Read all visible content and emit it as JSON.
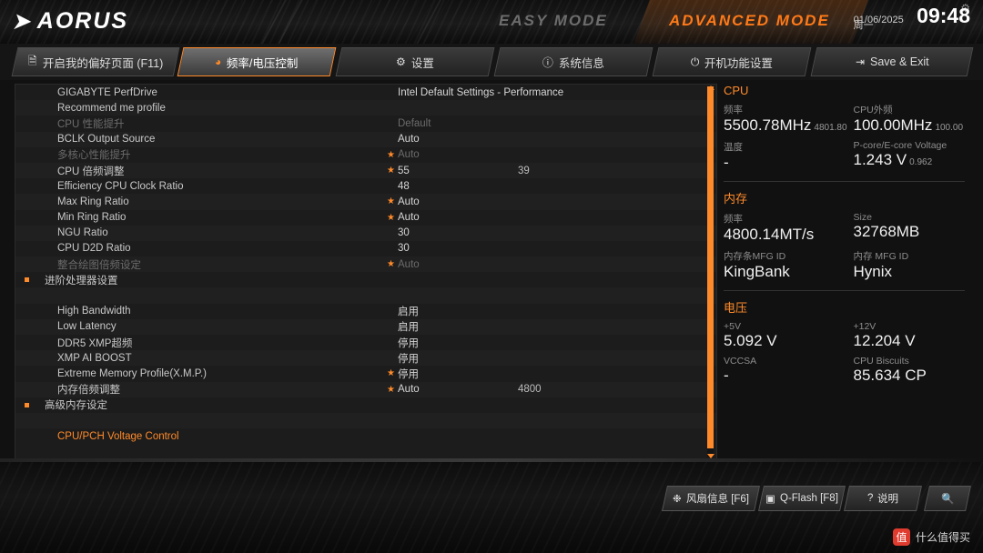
{
  "header": {
    "logo_text": "AORUS",
    "easy_mode": "EASY MODE",
    "advanced_mode": "ADVANCED MODE",
    "date": "01/06/2025",
    "weekday": "周一",
    "time": "09:48",
    "gear_icon": "gear-icon"
  },
  "tabs": [
    {
      "label": "开启我的偏好页面 (F11)",
      "icon": "bookmark-icon",
      "active": false
    },
    {
      "label": "频率/电压控制",
      "icon": "speedometer-icon",
      "active": true
    },
    {
      "label": "设置",
      "icon": "gear-icon",
      "active": false
    },
    {
      "label": "系统信息",
      "icon": "info-icon",
      "active": false
    },
    {
      "label": "开机功能设置",
      "icon": "power-icon",
      "active": false
    },
    {
      "label": "Save & Exit",
      "icon": "exit-icon",
      "active": false
    }
  ],
  "settings_rows": [
    {
      "label": "GIGABYTE PerfDrive",
      "value": "Intel Default Settings - Performance",
      "value2": "",
      "star": false,
      "dim": false,
      "bullet": false,
      "header": false
    },
    {
      "label": "Recommend me profile",
      "value": "",
      "value2": "",
      "star": false,
      "dim": false,
      "bullet": false,
      "header": false
    },
    {
      "label": "CPU 性能提升",
      "value": "Default",
      "value2": "",
      "star": false,
      "dim": true,
      "bullet": false,
      "header": false
    },
    {
      "label": "BCLK Output Source",
      "value": "Auto",
      "value2": "",
      "star": false,
      "dim": false,
      "bullet": false,
      "header": false
    },
    {
      "label": "多核心性能提升",
      "value": "Auto",
      "value2": "",
      "star": true,
      "dim": true,
      "bullet": false,
      "header": false
    },
    {
      "label": "CPU 倍频调整",
      "value": "55",
      "value2": "39",
      "star": true,
      "dim": false,
      "bullet": false,
      "header": false
    },
    {
      "label": "Efficiency CPU Clock Ratio",
      "value": "48",
      "value2": "",
      "star": false,
      "dim": false,
      "bullet": false,
      "header": false
    },
    {
      "label": "Max Ring Ratio",
      "value": "Auto",
      "value2": "",
      "star": true,
      "dim": false,
      "bullet": false,
      "header": false
    },
    {
      "label": "Min Ring Ratio",
      "value": "Auto",
      "value2": "",
      "star": true,
      "dim": false,
      "bullet": false,
      "header": false
    },
    {
      "label": "NGU Ratio",
      "value": "30",
      "value2": "",
      "star": false,
      "dim": false,
      "bullet": false,
      "header": false
    },
    {
      "label": "CPU D2D Ratio",
      "value": "30",
      "value2": "",
      "star": false,
      "dim": false,
      "bullet": false,
      "header": false
    },
    {
      "label": "整合绘图倍频设定",
      "value": "Auto",
      "value2": "",
      "star": true,
      "dim": true,
      "bullet": false,
      "header": false
    },
    {
      "label": "进阶处理器设置",
      "value": "",
      "value2": "",
      "star": false,
      "dim": false,
      "bullet": true,
      "header": false
    },
    {
      "label": "",
      "value": "",
      "value2": "",
      "star": false,
      "dim": false,
      "bullet": false,
      "header": false
    },
    {
      "label": "High Bandwidth",
      "value": "启用",
      "value2": "",
      "star": false,
      "dim": false,
      "bullet": false,
      "header": false
    },
    {
      "label": "Low Latency",
      "value": "启用",
      "value2": "",
      "star": false,
      "dim": false,
      "bullet": false,
      "header": false
    },
    {
      "label": "DDR5 XMP超频",
      "value": "停用",
      "value2": "",
      "star": false,
      "dim": false,
      "bullet": false,
      "header": false
    },
    {
      "label": "XMP AI BOOST",
      "value": "停用",
      "value2": "",
      "star": false,
      "dim": false,
      "bullet": false,
      "header": false
    },
    {
      "label": "Extreme Memory Profile(X.M.P.)",
      "value": "停用",
      "value2": "",
      "star": true,
      "dim": false,
      "bullet": false,
      "header": false
    },
    {
      "label": "内存倍频调整",
      "value": "Auto",
      "value2": "4800",
      "star": true,
      "dim": false,
      "bullet": false,
      "header": false
    },
    {
      "label": "高级内存设定",
      "value": "",
      "value2": "",
      "star": false,
      "dim": false,
      "bullet": true,
      "header": false
    },
    {
      "label": "",
      "value": "",
      "value2": "",
      "star": false,
      "dim": false,
      "bullet": false,
      "header": false
    },
    {
      "label": "CPU/PCH Voltage Control",
      "value": "",
      "value2": "",
      "star": false,
      "dim": false,
      "bullet": false,
      "header": true
    }
  ],
  "info": {
    "cpu": {
      "title": "CPU",
      "freq_key": "频率",
      "freq_value": "5500.78MHz",
      "freq_sub": "4801.80",
      "ext_freq_key": "CPU外频",
      "ext_freq_value": "100.00MHz",
      "ext_freq_sub": "100.00",
      "temp_key": "温度",
      "temp_value": "-",
      "voltage_key": "P-core/E-core Voltage",
      "voltage_value": "1.243 V",
      "voltage_sub": "0.962"
    },
    "memory": {
      "title": "内存",
      "freq_key": "频率",
      "freq_value": "4800.14MT/s",
      "size_key": "Size",
      "size_value": "32768MB",
      "mfg1_key": "内存条MFG ID",
      "mfg1_value": "KingBank",
      "mfg2_key": "内存 MFG ID",
      "mfg2_value": "Hynix"
    },
    "voltage": {
      "title": "电压",
      "p5v_key": "+5V",
      "p5v_value": "5.092 V",
      "p12v_key": "+12V",
      "p12v_value": "12.204 V",
      "vccsa_key": "VCCSA",
      "vccsa_value": "-",
      "biscuits_key": "CPU Biscuits",
      "biscuits_value": "85.634 CP"
    }
  },
  "bottom_buttons": [
    {
      "label": "风扇信息 [F6]",
      "icon": "fan-icon"
    },
    {
      "label": "Q-Flash [F8]",
      "icon": "flash-icon"
    },
    {
      "label": "说明",
      "icon": "question-icon"
    },
    {
      "label": "",
      "icon": "search-icon"
    }
  ],
  "watermark": {
    "badge": "值",
    "text": "什么值得买"
  }
}
